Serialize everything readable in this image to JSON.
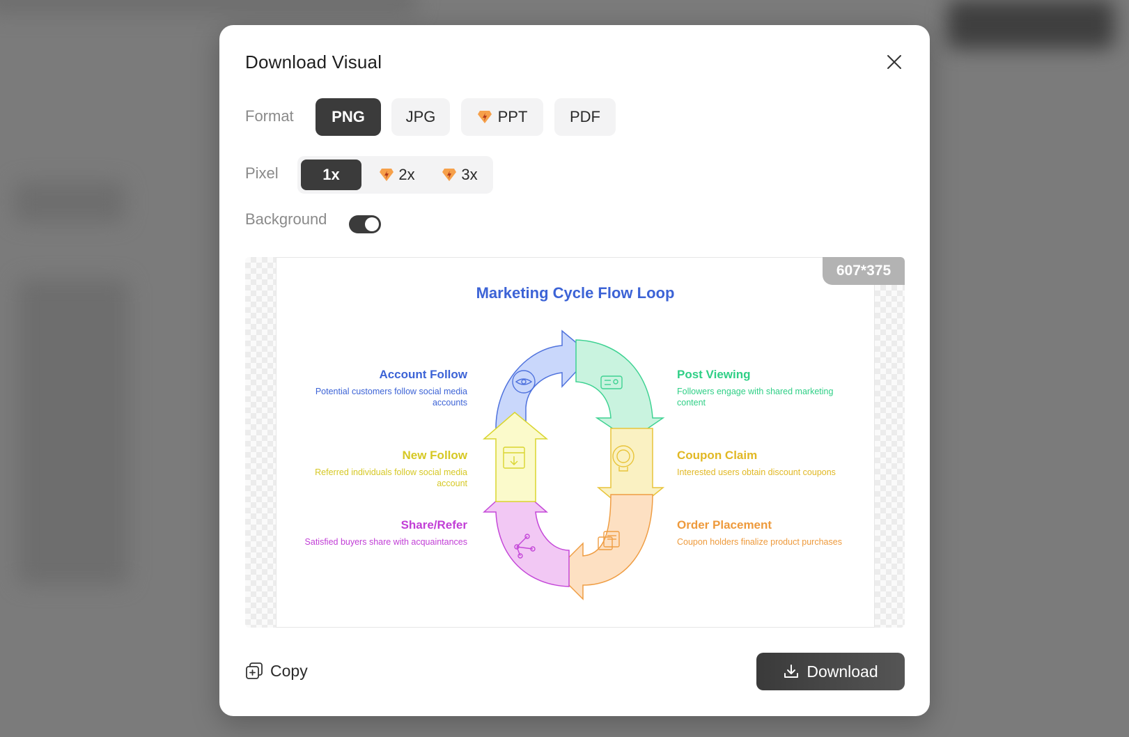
{
  "dialog": {
    "title": "Download Visual"
  },
  "format": {
    "label": "Format",
    "options": [
      "PNG",
      "JPG",
      "PPT",
      "PDF"
    ],
    "selected": "PNG",
    "premium": [
      "PPT"
    ]
  },
  "pixel": {
    "label": "Pixel",
    "options": [
      "1x",
      "2x",
      "3x"
    ],
    "selected": "1x",
    "premium": [
      "2x",
      "3x"
    ]
  },
  "background": {
    "label": "Background",
    "enabled": true
  },
  "preview": {
    "dimensions": "607*375",
    "title": "Marketing Cycle Flow Loop",
    "steps": [
      {
        "title": "Account Follow",
        "desc": "Potential customers follow social media accounts",
        "color": "#3c63d6",
        "icon": "eye-icon"
      },
      {
        "title": "Post Viewing",
        "desc": "Followers engage with shared marketing content",
        "color": "#2fcf86",
        "icon": "id-card-icon"
      },
      {
        "title": "Coupon Claim",
        "desc": "Interested users obtain discount coupons",
        "color": "#e1b824",
        "icon": "badge-icon"
      },
      {
        "title": "Order Placement",
        "desc": "Coupon holders finalize product purchases",
        "color": "#ee9a3c",
        "icon": "documents-icon"
      },
      {
        "title": "Share/Refer",
        "desc": "Satisfied buyers share with acquaintances",
        "color": "#c13ed6",
        "icon": "share-icon"
      },
      {
        "title": "New Follow",
        "desc": "Referred individuals follow social media account",
        "color": "#d8d62a",
        "icon": "download-icon"
      }
    ]
  },
  "footer": {
    "copy_label": "Copy",
    "download_label": "Download"
  },
  "colors": {
    "active_button": "#3b3b3b",
    "premium_gem": "#f6a04a"
  }
}
